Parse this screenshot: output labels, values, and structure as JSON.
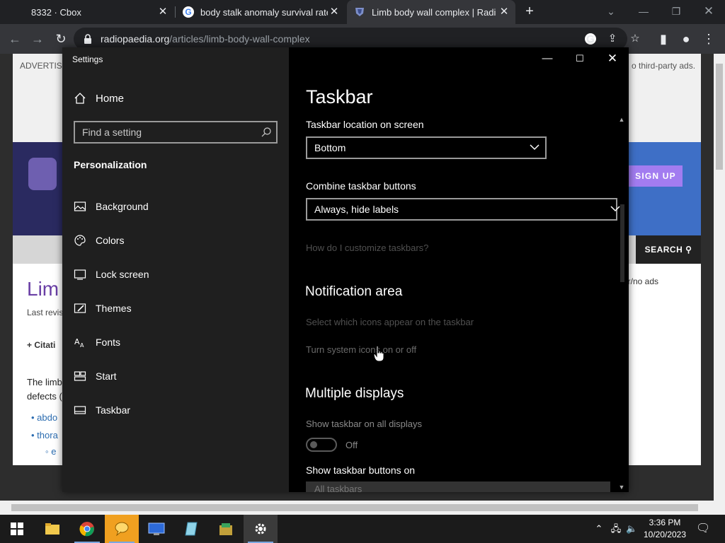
{
  "browser": {
    "tabs": [
      {
        "title": "8332 · Cbox",
        "close": "✕"
      },
      {
        "title": "body stalk anomaly survival rate",
        "close": "✕"
      },
      {
        "title": "Limb body wall complex | Radiol",
        "close": "✕"
      }
    ],
    "new_tab": "+",
    "url_domain": "radiopaedia.org",
    "url_path": "/articles/limb-body-wall-complex"
  },
  "webpage": {
    "advertise": "ADVERTISE",
    "third_party": "o third-party ads.",
    "signup": "SIGN UP",
    "search": "SEARCH",
    "heading": "Lim",
    "last_revised": "Last revis",
    "citation": "+  Citati",
    "para_line1": "The limb",
    "para_line2": "defects (",
    "list1": "• abdo",
    "list2": "• thora",
    "list3": "◦ e",
    "ads_right": "er/no ads"
  },
  "settings": {
    "window_title": "Settings",
    "home": "Home",
    "search_placeholder": "Find a setting",
    "section": "Personalization",
    "nav": [
      {
        "label": "Background",
        "icon": "picture-icon"
      },
      {
        "label": "Colors",
        "icon": "palette-icon"
      },
      {
        "label": "Lock screen",
        "icon": "lock-screen-icon"
      },
      {
        "label": "Themes",
        "icon": "themes-icon"
      },
      {
        "label": "Fonts",
        "icon": "fonts-icon"
      },
      {
        "label": "Start",
        "icon": "start-icon"
      },
      {
        "label": "Taskbar",
        "icon": "taskbar-icon"
      }
    ],
    "page_title": "Taskbar",
    "location_label": "Taskbar location on screen",
    "location_value": "Bottom",
    "combine_label": "Combine taskbar buttons",
    "combine_value": "Always, hide labels",
    "customize_link": "How do I customize taskbars?",
    "notification_heading": "Notification area",
    "select_icons": "Select which icons appear on the taskbar",
    "system_icons": "Turn system icons on or off",
    "multiple_heading": "Multiple displays",
    "show_all_label": "Show taskbar on all displays",
    "show_all_state": "Off",
    "show_buttons_label": "Show taskbar buttons on",
    "show_buttons_value": "All taskbars"
  },
  "taskbar": {
    "time": "3:36 PM",
    "date": "10/20/2023"
  }
}
